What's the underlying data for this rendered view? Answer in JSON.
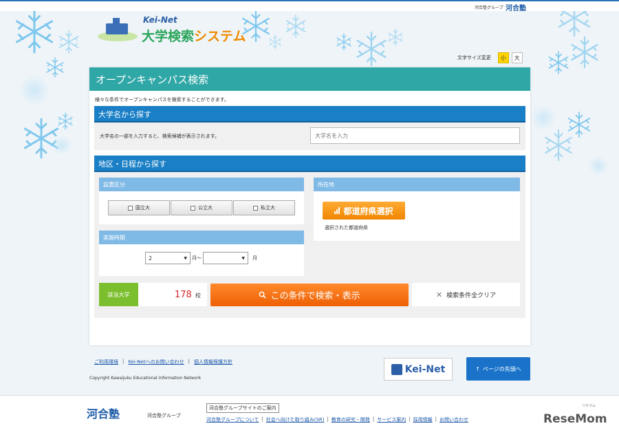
{
  "top_bar": {
    "group_label": "河合塾グループ",
    "group_logo": "河合塾"
  },
  "site": {
    "brand": "Kei-Net",
    "title_main": "大学検索",
    "title_accent": "システム"
  },
  "font_size": {
    "label": "文字サイズ変更",
    "small": "小",
    "large": "大",
    "selected": "small"
  },
  "panel": {
    "title": "オープンキャンパス検索",
    "intro": "様々な条件でオープンキャンパスを検索することができます。"
  },
  "name_search": {
    "heading": "大学名から探す",
    "hint": "大学名の一部を入力すると、検索候補が表示されます。",
    "placeholder": "大学名を入力",
    "value": ""
  },
  "region_search": {
    "heading": "地区・日程から探す",
    "type": {
      "heading": "設置区分",
      "options": [
        "国立大",
        "公立大",
        "私立大"
      ]
    },
    "period": {
      "heading": "実施時期",
      "from_value": "2",
      "from_suffix": "月～",
      "to_value": "",
      "to_suffix": "月"
    },
    "location": {
      "heading": "所在地",
      "button": "都道府県選択",
      "selected_label": "選択された都道府県"
    }
  },
  "result": {
    "label": "該当大学",
    "count": "178",
    "unit": "校",
    "search_button": "この条件で検索・表示",
    "clear_button": "検索条件全クリア"
  },
  "footer_links": [
    "ご利用環境",
    "Kei-Netへのお問い合わせ",
    "個人情報保護方針"
  ],
  "copyright": "Copyright Kawaijuku Educational Information Network",
  "keinet_logo": "Kei-Net",
  "page_top": "ページの先頭へ",
  "footer": {
    "logo": "河合塾",
    "logo_sub": "河合塾グループ",
    "group_link": "河合塾グループサイトのご案内",
    "nav": [
      "河合塾グループについて",
      "社会へ向けた取り組み(SR)",
      "教育の研究・開発",
      "サービス案内",
      "採用情報",
      "お問い合わせ"
    ]
  },
  "watermark": {
    "text": "ReseMom",
    "sub": "リセマム"
  },
  "colors": {
    "teal_header": "#2fa7a6",
    "section_blue": "#1a7fc6",
    "search_orange": "#ee5f05",
    "count_green": "#7cbf2e",
    "count_red": "#d8262b"
  }
}
